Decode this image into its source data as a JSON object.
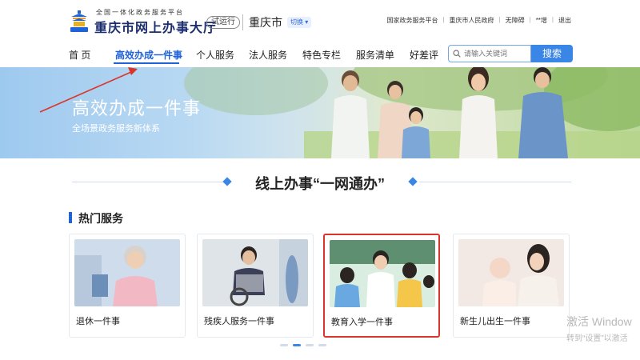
{
  "header": {
    "platform_tagline": "全国一体化政务服务平台",
    "site_name": "重庆市网上办事大厅",
    "trial_badge": "试运行",
    "city": "重庆市",
    "switch_label": "切换",
    "top_links": [
      "国家政务服务平台",
      "重庆市人民政府",
      "无障碍",
      "**增",
      "退出"
    ]
  },
  "nav": {
    "items": [
      "首 页",
      "高效办成一件事",
      "个人服务",
      "法人服务",
      "特色专栏",
      "服务清单",
      "好差评"
    ],
    "active_index": 1
  },
  "search": {
    "placeholder": "请输入关键词",
    "button_label": "搜索"
  },
  "banner": {
    "title": "高效办成一件事",
    "subtitle": "全场景政务服务新体系"
  },
  "section": {
    "title": "线上办事“一网通办”"
  },
  "hot_services": {
    "title": "热门服务",
    "cards": [
      {
        "label": "退休一件事"
      },
      {
        "label": "残疾人服务一件事"
      },
      {
        "label": "教育入学一件事"
      },
      {
        "label": "新生儿出生一件事"
      }
    ],
    "highlighted_index": 2
  },
  "carousel": {
    "active_page": 1,
    "total_pages": 4
  },
  "watermark": {
    "line1": "激活 Window",
    "line2": "转到“设置”以激活"
  },
  "colors": {
    "accent": "#1f63d8",
    "search_button": "#3a86e6",
    "highlight_border": "#d9352a",
    "annotation_arrow": "#d9352a"
  }
}
